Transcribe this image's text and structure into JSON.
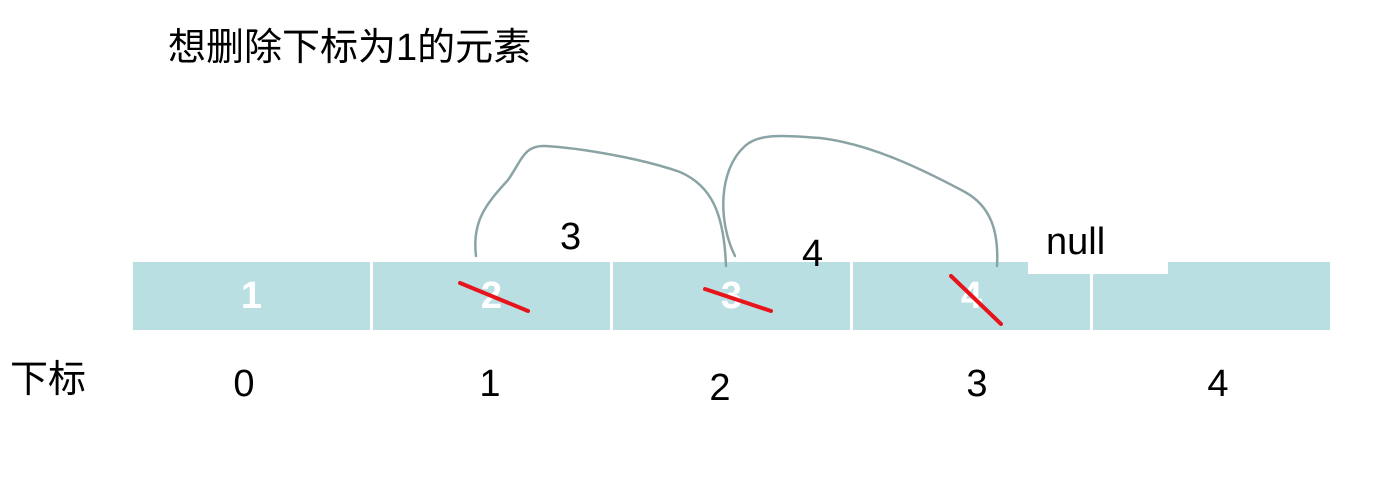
{
  "title": "想删除下标为1的元素",
  "array": {
    "cells": [
      "1",
      "2",
      "3",
      "4",
      ""
    ]
  },
  "index_row": {
    "label": "下标",
    "indices": [
      "0",
      "1",
      "2",
      "3",
      "4"
    ]
  },
  "shifted_values": [
    "3",
    "4",
    "null"
  ],
  "colors": {
    "cell_fill": "#b9dfe3",
    "cell_text": "#ffffff",
    "strike": "#e8141b",
    "arrow": "#8aa4a6"
  }
}
